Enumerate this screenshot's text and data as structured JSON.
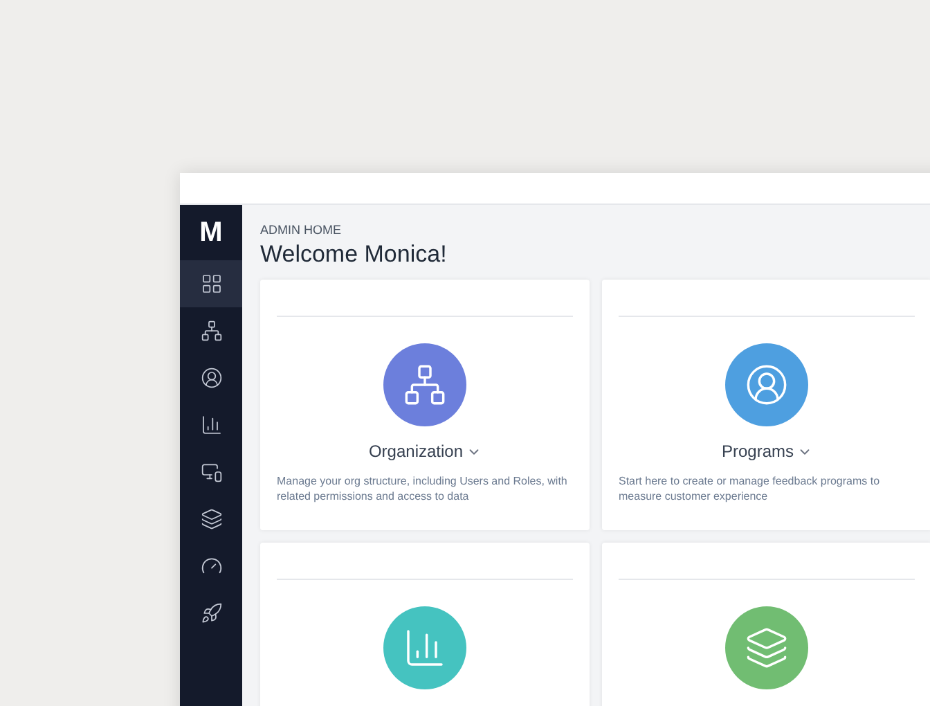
{
  "logo": {
    "letter": "M"
  },
  "sidebar": {
    "items": [
      {
        "kind": "grid",
        "selected": true
      },
      {
        "kind": "org",
        "selected": false
      },
      {
        "kind": "people",
        "selected": false
      },
      {
        "kind": "chart",
        "selected": false
      },
      {
        "kind": "screens",
        "selected": false
      },
      {
        "kind": "layers",
        "selected": false
      },
      {
        "kind": "gauge",
        "selected": false
      },
      {
        "kind": "rocket",
        "selected": false
      }
    ]
  },
  "header": {
    "eyebrow": "ADMIN HOME",
    "title": "Welcome Monica!"
  },
  "cards": [
    {
      "kind": "org",
      "color": "#6c7fdc",
      "title": "Organization",
      "description": "Manage your org structure, including Users and Roles, with related permissions and access to data"
    },
    {
      "kind": "people",
      "color": "#4e9fe0",
      "title": "Programs",
      "description": "Start here to create or manage feedback programs to measure customer experience"
    },
    {
      "kind": "chart",
      "color": "#45c3c0"
    },
    {
      "kind": "layers",
      "color": "#71bd72"
    }
  ]
}
